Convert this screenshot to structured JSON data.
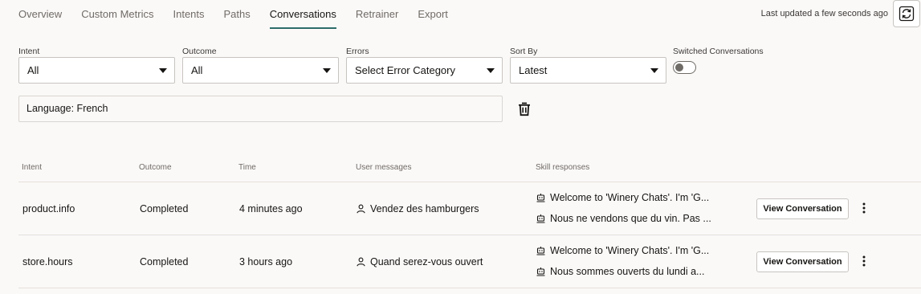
{
  "tabs": [
    {
      "label": "Overview"
    },
    {
      "label": "Custom Metrics"
    },
    {
      "label": "Intents"
    },
    {
      "label": "Paths"
    },
    {
      "label": "Conversations",
      "active": true
    },
    {
      "label": "Retrainer"
    },
    {
      "label": "Export"
    }
  ],
  "last_updated": "Last updated a few seconds ago",
  "filters": {
    "intent": {
      "label": "Intent",
      "value": "All"
    },
    "outcome": {
      "label": "Outcome",
      "value": "All"
    },
    "errors": {
      "label": "Errors",
      "value": "Select Error Category"
    },
    "sort_by": {
      "label": "Sort By",
      "value": "Latest"
    },
    "switched": {
      "label": "Switched Conversations",
      "on": false
    }
  },
  "applied_filter": "Language: French",
  "table": {
    "headers": {
      "intent": "Intent",
      "outcome": "Outcome",
      "time": "Time",
      "user_messages": "User messages",
      "skill_responses": "Skill responses"
    },
    "rows": [
      {
        "intent": "product.info",
        "outcome": "Completed",
        "time": "4 minutes ago",
        "user_message": "Vendez des hamburgers",
        "responses": [
          "Welcome to 'Winery Chats'. I'm 'G...",
          "Nous ne vendons que du vin. Pas ..."
        ],
        "action": "View Conversation"
      },
      {
        "intent": "store.hours",
        "outcome": "Completed",
        "time": "3 hours ago",
        "user_message": "Quand serez-vous ouvert",
        "responses": [
          "Welcome to 'Winery Chats'. I'm 'G...",
          "Nous sommes ouverts du lundi a..."
        ],
        "action": "View Conversation"
      }
    ]
  },
  "icons": {
    "refresh": "refresh-icon",
    "trash": "trash-icon",
    "user": "user-icon",
    "bot": "bot-icon",
    "more": "kebab-menu-icon",
    "caret": "chevron-down-icon"
  },
  "colors": {
    "accent": "#2d6d6a",
    "background": "#fbf9f8"
  }
}
